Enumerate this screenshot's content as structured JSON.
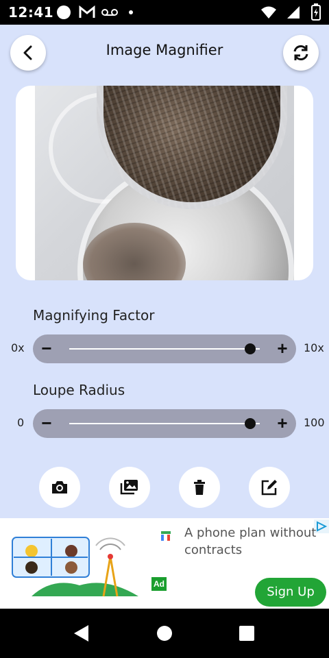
{
  "status_bar": {
    "time": "12:41",
    "icons": [
      "circle-notification-icon",
      "gmail-icon",
      "voicemail-icon",
      "dot-icon",
      "wifi-icon",
      "signal-icon",
      "battery-charging-icon"
    ]
  },
  "header": {
    "title": "Image Magnifier",
    "back_icon": "chevron-left-icon",
    "refresh_icon": "refresh-icon"
  },
  "image_preview": {
    "description_icon": "magnified-coin-image"
  },
  "sliders": [
    {
      "label": "Magnifying Factor",
      "min_label": "0x",
      "max_label": "10x",
      "value_fraction": 0.95
    },
    {
      "label": "Loupe Radius",
      "min_label": "0",
      "max_label": "100",
      "value_fraction": 0.95
    }
  ],
  "actions": [
    "camera-icon",
    "gallery-icon",
    "trash-icon",
    "edit-icon"
  ],
  "ad": {
    "text": "A phone plan without contracts",
    "badge": "Ad",
    "cta": "Sign Up"
  },
  "colors": {
    "background": "#d8e2fb",
    "slider_track": "#9ea0b3",
    "cta_green": "#22a536"
  }
}
